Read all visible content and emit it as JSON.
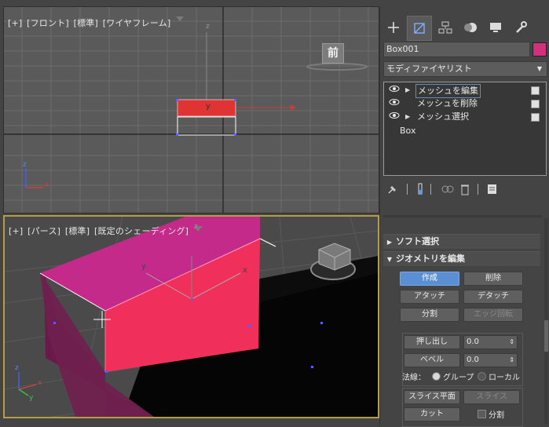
{
  "viewport_top": {
    "labels": [
      "[+]",
      "[フロント]",
      "[標準]",
      "[ワイヤフレーム]"
    ],
    "viewcube_label": "前",
    "axis_z": "z",
    "axis_y": "y",
    "gizmo_x": "x",
    "gizmo_z": "z"
  },
  "viewport_persp": {
    "labels": [
      "[+]",
      "[パース]",
      "[標準]",
      "[既定のシェーディング]"
    ],
    "axis_y": "y",
    "axis_x": "x",
    "axis_z": "z",
    "gizmo_x": "x",
    "gizmo_y": "y",
    "gizmo_z": "z"
  },
  "panel": {
    "object_name": "Box001",
    "object_color": "#d0307c",
    "modifier_list": "モディファイヤリスト",
    "stack": [
      {
        "label": "メッシュを編集",
        "eye": true,
        "expand": true,
        "selected": true
      },
      {
        "label": "メッシュを削除",
        "eye": true,
        "expand": false,
        "selected": false
      },
      {
        "label": "メッシュ選択",
        "eye": true,
        "expand": true,
        "selected": false
      },
      {
        "label": "Box",
        "eye": false,
        "expand": false,
        "selected": false
      }
    ],
    "rollouts": {
      "soft_select": "ソフト選択",
      "edit_geometry": "ジオメトリを編集"
    },
    "buttons": {
      "create": "作成",
      "delete": "削除",
      "attach": "アタッチ",
      "detach": "デタッチ",
      "divide": "分割",
      "edge_rotate": "エッジ回転",
      "extrude": "押し出し",
      "bevel": "ベベル",
      "slice_plane": "スライス平面",
      "slice": "スライス",
      "cut": "カット",
      "split": "分割"
    },
    "extrude_value": "0.0",
    "bevel_value": "0.0",
    "normals_label": "法線：",
    "normals_group": "グループ",
    "normals_local": "ローカル"
  }
}
